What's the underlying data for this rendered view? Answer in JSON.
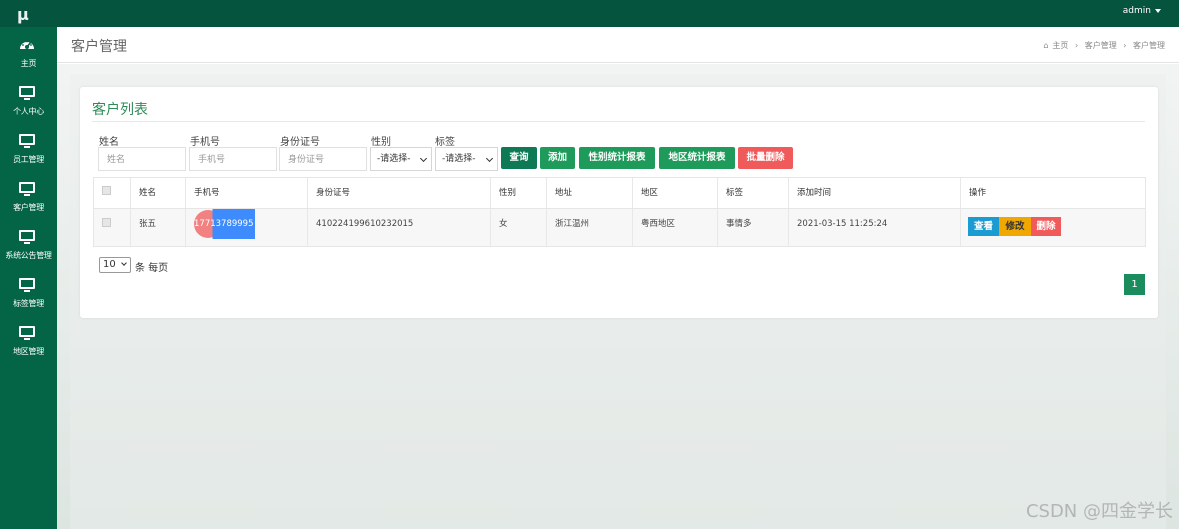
{
  "app": {
    "logo": "μ",
    "user_menu": "admin"
  },
  "sidebar": {
    "items": [
      {
        "label": "主页",
        "icon": "dashboard-icon"
      },
      {
        "label": "个人中心",
        "icon": "monitor-icon"
      },
      {
        "label": "员工管理",
        "icon": "monitor-icon"
      },
      {
        "label": "客户管理",
        "icon": "monitor-icon"
      },
      {
        "label": "系统公告管理",
        "icon": "monitor-icon"
      },
      {
        "label": "标签管理",
        "icon": "monitor-icon"
      },
      {
        "label": "地区管理",
        "icon": "monitor-icon"
      }
    ]
  },
  "header": {
    "title": "客户管理",
    "breadcrumb": [
      "主页",
      "客户管理",
      "客户管理"
    ],
    "breadcrumb_sep": "›"
  },
  "panel": {
    "title": "客户列表"
  },
  "filters": {
    "name": {
      "label": "姓名",
      "placeholder": "姓名"
    },
    "phone": {
      "label": "手机号",
      "placeholder": "手机号"
    },
    "idcard": {
      "label": "身份证号",
      "placeholder": "身份证号"
    },
    "gender": {
      "label": "性别",
      "selected": "-请选择-"
    },
    "tag": {
      "label": "标签",
      "selected": "-请选择-"
    }
  },
  "buttons": {
    "search": "查询",
    "add": "添加",
    "gender_report": "性别统计报表",
    "region_report": "地区统计报表",
    "batch_delete": "批量删除"
  },
  "table": {
    "columns": [
      "姓名",
      "手机号",
      "身份证号",
      "性别",
      "地址",
      "地区",
      "标签",
      "添加时间",
      "操作"
    ],
    "rows": [
      {
        "name": "张五",
        "phone": "17713789995",
        "idcard": "410224199610232015",
        "gender": "女",
        "address": "浙江温州",
        "region": "粤西地区",
        "tag": "事情多",
        "added": "2021-03-15 11:25:24"
      }
    ],
    "actions": {
      "view": "查看",
      "edit": "修改",
      "delete": "删除"
    }
  },
  "pagination": {
    "page_size": "10",
    "page_size_suffix": "条 每页",
    "current_page": "1"
  },
  "watermark": "CSDN @四金学长",
  "colors": {
    "topbar": "#04543e",
    "sidebar": "#046446",
    "primary_green": "#1a8c5e",
    "danger_red": "#f05a5a",
    "warning_yellow": "#f0a800",
    "info_blue": "#1a9bd1"
  }
}
